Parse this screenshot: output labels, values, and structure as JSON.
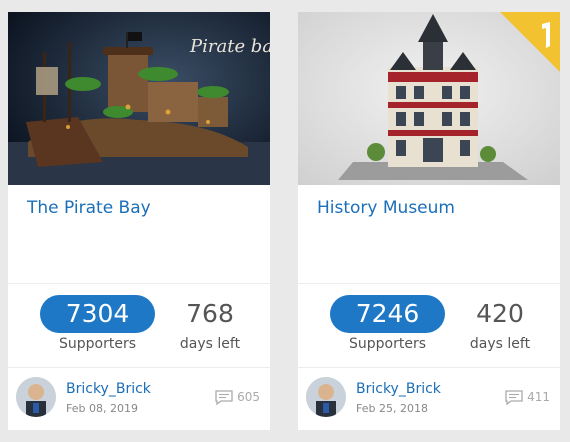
{
  "projects": [
    {
      "title": "The Pirate Bay",
      "image_text": "Pirate bay",
      "supporters": "7304",
      "supporters_label": "Supporters",
      "days": "768",
      "days_label": "days left",
      "author": "Bricky_Brick",
      "date": "Feb 08, 2019",
      "comments": "605"
    },
    {
      "title": "History Museum",
      "supporters": "7246",
      "supporters_label": "Supporters",
      "days": "420",
      "days_label": "days left",
      "author": "Bricky_Brick",
      "date": "Feb 25, 2018",
      "comments": "411"
    }
  ],
  "colors": {
    "accent": "#1e78c6",
    "link": "#1b6fb8",
    "ribbon": "#f2c230",
    "background": "#e9e9e9"
  }
}
